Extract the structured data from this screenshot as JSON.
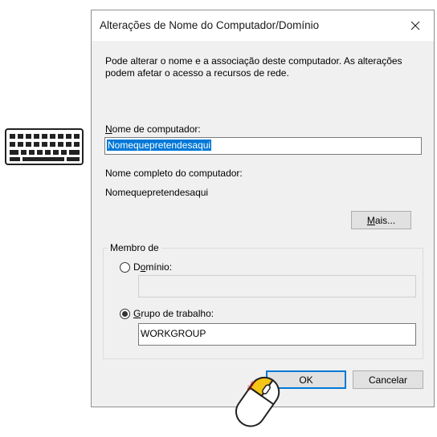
{
  "dialog": {
    "title": "Alterações de Nome do Computador/Domínio",
    "description": "Pode alterar o nome e a associação deste computador. As alterações podem afetar o acesso a recursos de rede.",
    "computer_name_label_accel": "N",
    "computer_name_label_rest": "ome de computador:",
    "computer_name_value": "Nomequepretendesaqui",
    "full_name_label": "Nome completo do computador:",
    "full_name_value": "Nomequepretendesaqui",
    "more_label_accel": "M",
    "more_label_rest": "ais...",
    "member_of_label": "Membro de",
    "domain_label_pre": "D",
    "domain_label_accel": "o",
    "domain_label_rest": "mínio:",
    "domain_value": "",
    "workgroup_label_accel": "G",
    "workgroup_label_rest": "rupo de trabalho:",
    "workgroup_value": "WORKGROUP",
    "ok_label": "OK",
    "cancel_label": "Cancelar",
    "selected_membership": "workgroup"
  },
  "overlay": {
    "click_text": "click",
    "keyboard_icon": "keyboard-icon",
    "mouse_icon": "mouse-icon"
  },
  "colors": {
    "selection": "#0078d7",
    "mouse_button": "#f5c518"
  }
}
